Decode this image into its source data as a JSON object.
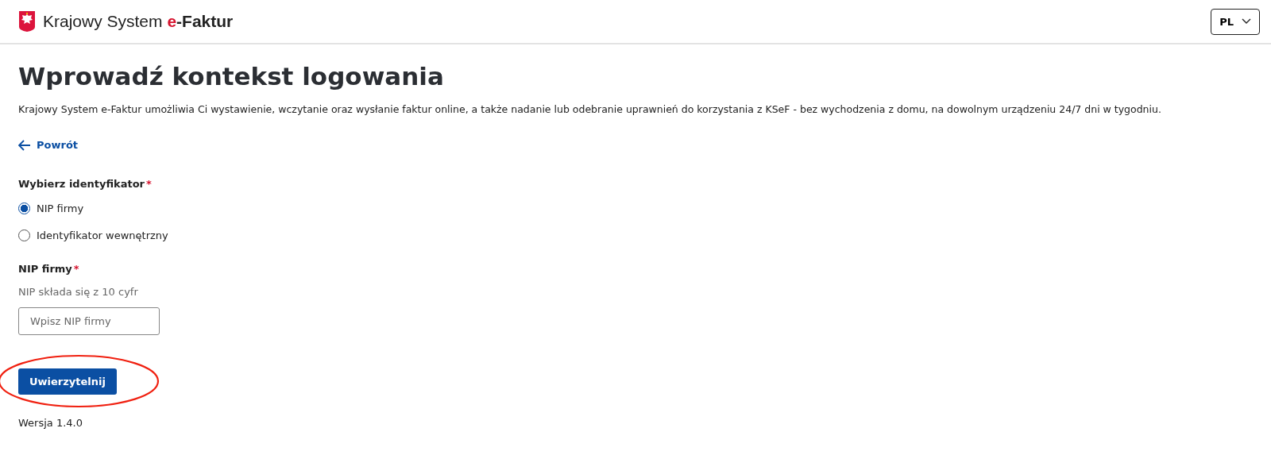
{
  "header": {
    "brand": {
      "prefix": "Krajowy System",
      "highlight": "e",
      "suffix": "-Faktur"
    },
    "language": "PL"
  },
  "title": "Wprowadź kontekst logowania",
  "description": "Krajowy System e-Faktur umożliwia Ci wystawienie, wczytanie oraz wysłanie faktur online, a także nadanie lub odebranie uprawnień do korzystania z KSeF - bez wychodzenia z domu, na dowolnym urządzeniu 24/7 dni w tygodniu.",
  "back_link": "Powrót",
  "identifier": {
    "label": "Wybierz identyfikator",
    "required_mark": "*",
    "options": [
      {
        "label": "NIP firmy",
        "selected": true
      },
      {
        "label": "Identyfikator wewnętrzny",
        "selected": false
      }
    ]
  },
  "nip_field": {
    "label": "NIP firmy",
    "required_mark": "*",
    "hint": "NIP składa się z 10 cyfr",
    "placeholder": "Wpisz NIP firmy"
  },
  "submit_button": {
    "label": "Uwierzytelnij",
    "highlighted": true
  },
  "version": "Wersja 1.4.0"
}
